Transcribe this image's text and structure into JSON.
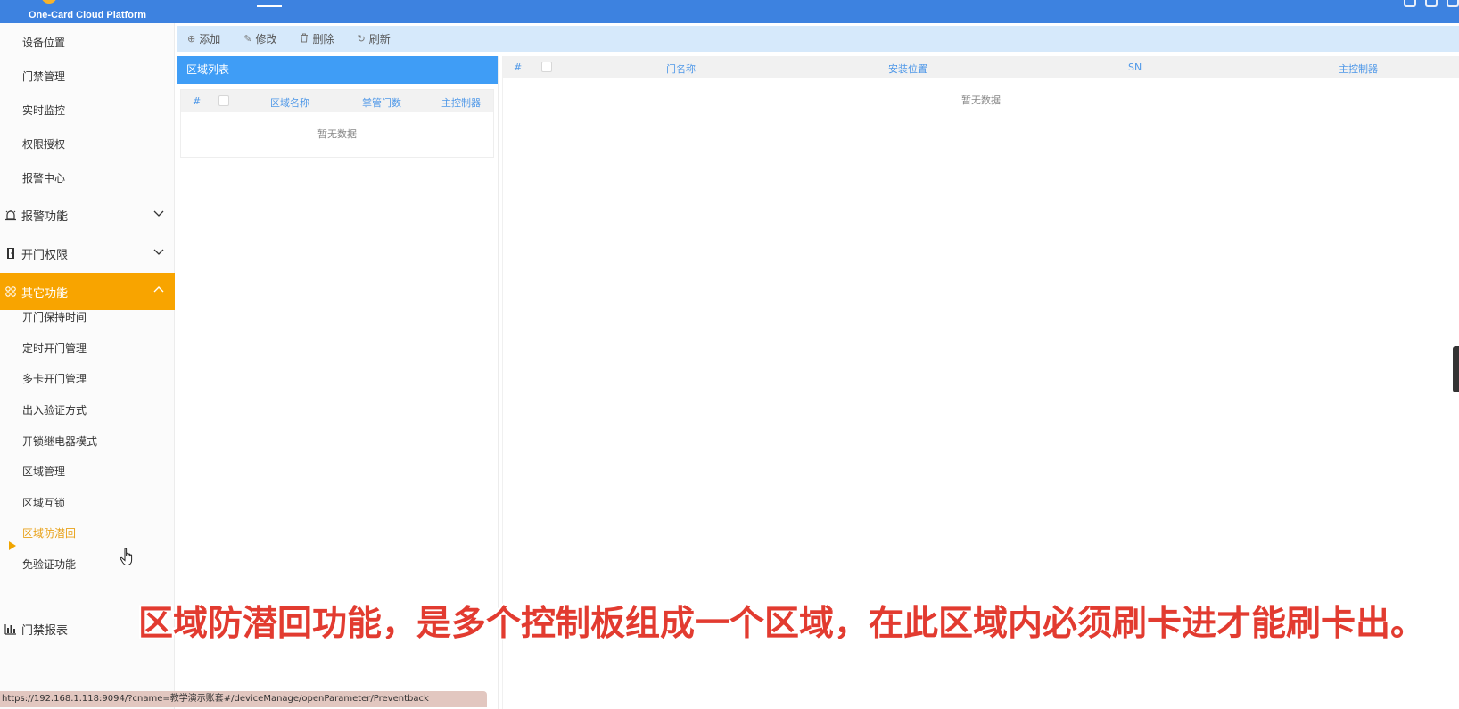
{
  "header": {
    "logo_text": "One-Card Cloud Platform"
  },
  "sidebar": {
    "top_items": [
      {
        "label": "设备位置"
      },
      {
        "label": "门禁管理"
      },
      {
        "label": "实时监控"
      },
      {
        "label": "权限授权"
      },
      {
        "label": "报警中心"
      }
    ],
    "groups": [
      {
        "label": "报警功能",
        "icon": "alarm-bell-icon",
        "expanded": false
      },
      {
        "label": "开门权限",
        "icon": "door-icon",
        "expanded": false
      },
      {
        "label": "其它功能",
        "icon": "grid-apps-icon",
        "expanded": true,
        "active": true
      }
    ],
    "other_items": [
      {
        "label": "开门保持时间"
      },
      {
        "label": "定时开门管理"
      },
      {
        "label": "多卡开门管理"
      },
      {
        "label": "出入验证方式"
      },
      {
        "label": "开锁继电器模式"
      },
      {
        "label": "区域管理"
      },
      {
        "label": "区域互锁"
      },
      {
        "label": "区域防潜回",
        "current": true
      },
      {
        "label": "免验证功能"
      }
    ],
    "report_group": {
      "label": "门禁报表",
      "icon": "bar-chart-icon"
    },
    "active_color": "#f8a400"
  },
  "toolbar": {
    "add_label": "添加",
    "edit_label": "修改",
    "delete_label": "删除",
    "refresh_label": "刷新"
  },
  "area_panel": {
    "title": "区域列表",
    "columns": [
      "#",
      "区域名称",
      "掌管门数",
      "主控制器"
    ],
    "empty_text": "暂无数据"
  },
  "door_table": {
    "columns": [
      "#",
      "门名称",
      "安装位置",
      "SN",
      "主控制器"
    ],
    "empty_text": "暂无数据"
  },
  "status_url": "https://192.168.1.118:9094/?cname=教学演示账套#/deviceManage/openParameter/Preventback",
  "subtitle": "区域防潜回功能，是多个控制板组成一个区域，在此区域内必须刷卡进才能刷卡出。",
  "colors": {
    "header": "#3d82e0",
    "panel_header": "#3f9df6",
    "toolbar": "#d6e9fb",
    "subtitle": "#e23b30"
  }
}
